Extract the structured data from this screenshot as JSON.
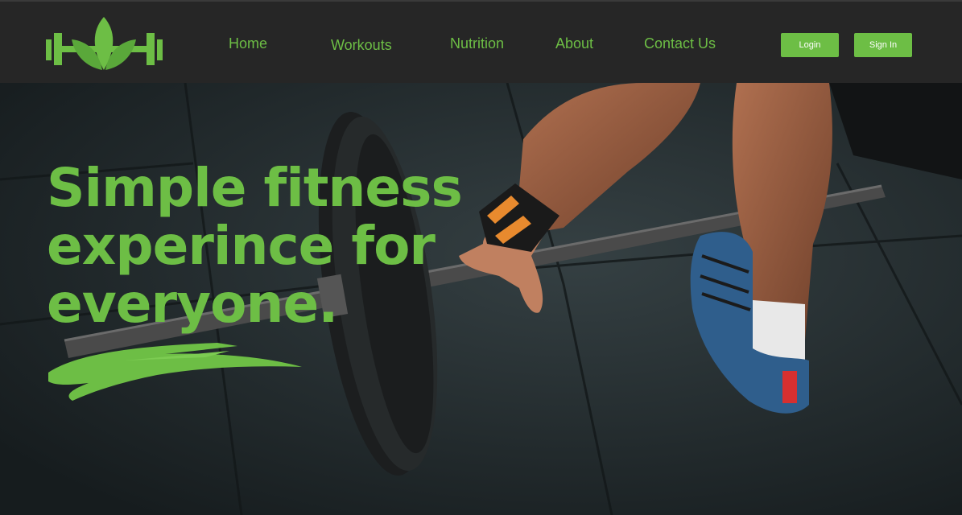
{
  "brand": {
    "logo_icon": "dumbbell-leaf-logo",
    "accent": "#6dbe45"
  },
  "nav": {
    "items": [
      {
        "label": "Home"
      },
      {
        "label": "Workouts"
      },
      {
        "label": "Nutrition"
      },
      {
        "label": "About"
      },
      {
        "label": "Contact Us"
      }
    ],
    "login_label": "Login",
    "signin_label": "Sign In"
  },
  "hero": {
    "headline_lines": [
      "Simple fitness",
      "experince for",
      "everyone."
    ],
    "image_icon": "barbell-deadlift-photo"
  },
  "colors": {
    "navbar_bg": "#262626",
    "accent": "#6dbe45",
    "hero_bg": "#242b2d"
  }
}
